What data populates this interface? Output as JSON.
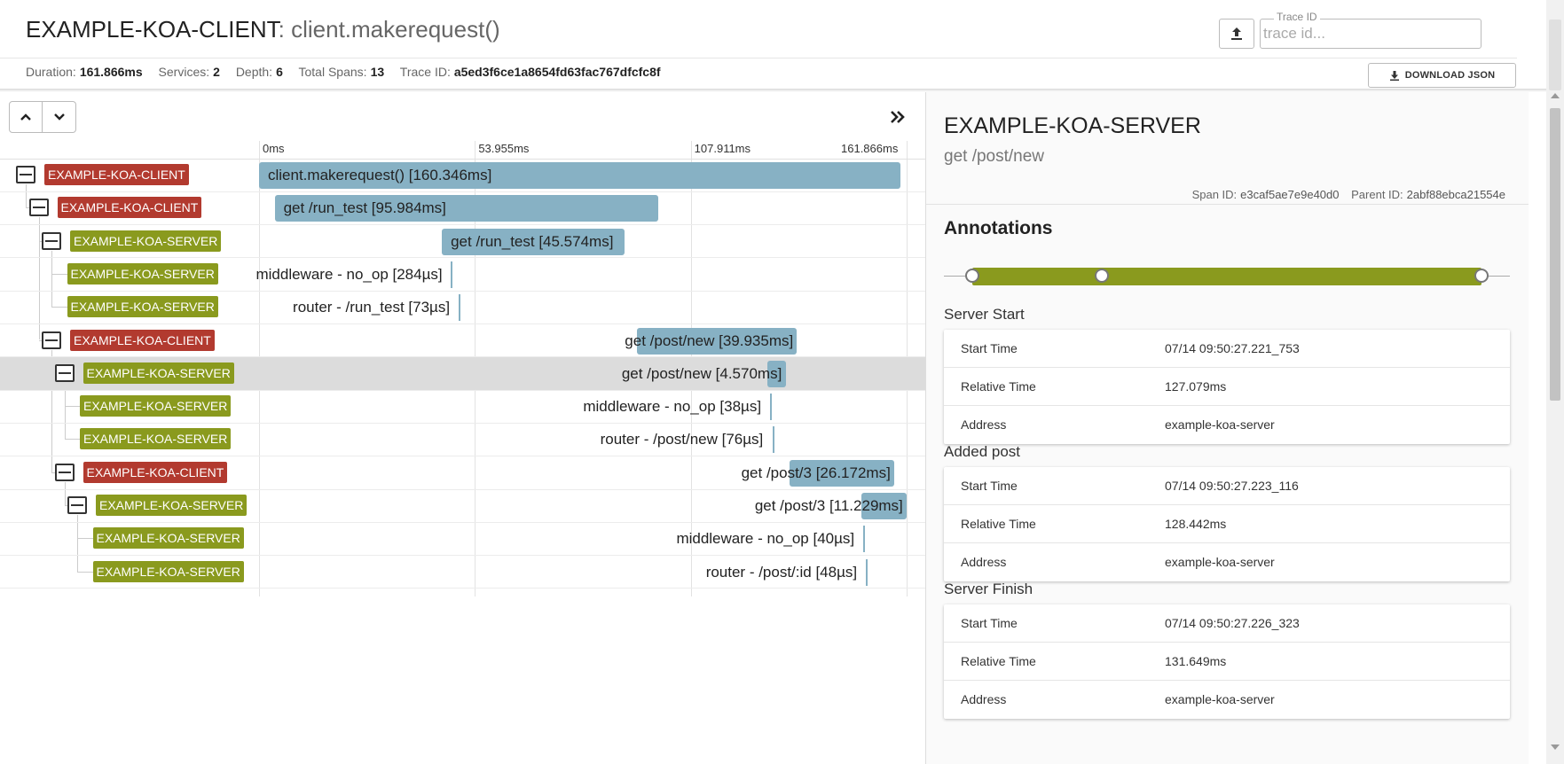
{
  "header": {
    "service": "EXAMPLE-KOA-CLIENT",
    "separator": ": ",
    "operation": "client.makerequest()",
    "stats": [
      {
        "label": "Duration:",
        "value": "161.866ms"
      },
      {
        "label": "Services:",
        "value": "2"
      },
      {
        "label": "Depth:",
        "value": "6"
      },
      {
        "label": "Total Spans:",
        "value": "13"
      },
      {
        "label": "Trace ID:",
        "value": "a5ed3f6ce1a8654fd63fac767dfcfc8f"
      }
    ],
    "trace_id_label": "Trace ID",
    "trace_id_placeholder": "trace id...",
    "download_label": "DOWNLOAD JSON"
  },
  "timeline": {
    "ticks": [
      "0ms",
      "53.955ms",
      "107.911ms",
      "161.866ms"
    ],
    "total_ms": 161.866,
    "spans": [
      {
        "service": "EXAMPLE-KOA-CLIENT",
        "kind": "client",
        "depth": 0,
        "expandable": true,
        "label": "client.makerequest() [160.346ms]",
        "start_ms": 0.0,
        "duration_ms": 160.346
      },
      {
        "service": "EXAMPLE-KOA-CLIENT",
        "kind": "client",
        "depth": 1,
        "expandable": true,
        "label": "get /run_test [95.984ms]",
        "start_ms": 3.9,
        "duration_ms": 95.984
      },
      {
        "service": "EXAMPLE-KOA-SERVER",
        "kind": "server",
        "depth": 2,
        "expandable": true,
        "label": "get /run_test [45.574ms]",
        "start_ms": 45.7,
        "duration_ms": 45.574
      },
      {
        "service": "EXAMPLE-KOA-SERVER",
        "kind": "server",
        "depth": 3,
        "expandable": false,
        "label": "middleware - no_op [284µs]",
        "start_ms": 48.0,
        "duration_ms": 0.284
      },
      {
        "service": "EXAMPLE-KOA-SERVER",
        "kind": "server",
        "depth": 3,
        "expandable": false,
        "label": "router - /run_test [73µs]",
        "start_ms": 49.9,
        "duration_ms": 0.073
      },
      {
        "service": "EXAMPLE-KOA-CLIENT",
        "kind": "client",
        "depth": 2,
        "expandable": true,
        "label": "get /post/new [39.935ms]",
        "start_ms": 94.5,
        "duration_ms": 39.935
      },
      {
        "service": "EXAMPLE-KOA-SERVER",
        "kind": "server",
        "depth": 3,
        "expandable": true,
        "label": "get /post/new [4.570ms]",
        "start_ms": 127.1,
        "duration_ms": 4.57,
        "selected": true
      },
      {
        "service": "EXAMPLE-KOA-SERVER",
        "kind": "server",
        "depth": 4,
        "expandable": false,
        "label": "middleware - no_op [38µs]",
        "start_ms": 127.8,
        "duration_ms": 0.038
      },
      {
        "service": "EXAMPLE-KOA-SERVER",
        "kind": "server",
        "depth": 4,
        "expandable": false,
        "label": "router - /post/new [76µs]",
        "start_ms": 128.3,
        "duration_ms": 0.076
      },
      {
        "service": "EXAMPLE-KOA-CLIENT",
        "kind": "client",
        "depth": 3,
        "expandable": true,
        "label": "get /post/3 [26.172ms]",
        "start_ms": 132.5,
        "duration_ms": 26.172
      },
      {
        "service": "EXAMPLE-KOA-SERVER",
        "kind": "server",
        "depth": 4,
        "expandable": true,
        "label": "get /post/3 [11.229ms]",
        "start_ms": 150.6,
        "duration_ms": 11.229
      },
      {
        "service": "EXAMPLE-KOA-SERVER",
        "kind": "server",
        "depth": 5,
        "expandable": false,
        "label": "middleware - no_op [40µs]",
        "start_ms": 151.1,
        "duration_ms": 0.04
      },
      {
        "service": "EXAMPLE-KOA-SERVER",
        "kind": "server",
        "depth": 5,
        "expandable": false,
        "label": "router - /post/:id [48µs]",
        "start_ms": 151.6,
        "duration_ms": 0.048
      }
    ]
  },
  "detail": {
    "service": "EXAMPLE-KOA-SERVER",
    "operation": "get /post/new",
    "span_id_label": "Span ID:",
    "span_id": "e3caf5ae7e9e40d0",
    "parent_id_label": "Parent ID:",
    "parent_id": "2abf88ebca21554e",
    "annotations_title": "Annotations",
    "annotations": [
      {
        "title": "Server Start",
        "rows": [
          {
            "key": "Start Time",
            "value": "07/14 09:50:27.221_753"
          },
          {
            "key": "Relative Time",
            "value": "127.079ms"
          },
          {
            "key": "Address",
            "value": "example-koa-server"
          }
        ]
      },
      {
        "title": "Added post",
        "rows": [
          {
            "key": "Start Time",
            "value": "07/14 09:50:27.223_116"
          },
          {
            "key": "Relative Time",
            "value": "128.442ms"
          },
          {
            "key": "Address",
            "value": "example-koa-server"
          }
        ]
      },
      {
        "title": "Server Finish",
        "rows": [
          {
            "key": "Start Time",
            "value": "07/14 09:50:27.226_323"
          },
          {
            "key": "Relative Time",
            "value": "131.649ms"
          },
          {
            "key": "Address",
            "value": "example-koa-server"
          }
        ]
      }
    ]
  },
  "colors": {
    "client": "#b23a2f",
    "server": "#8a9a1e",
    "bar": "#87b1c4"
  }
}
